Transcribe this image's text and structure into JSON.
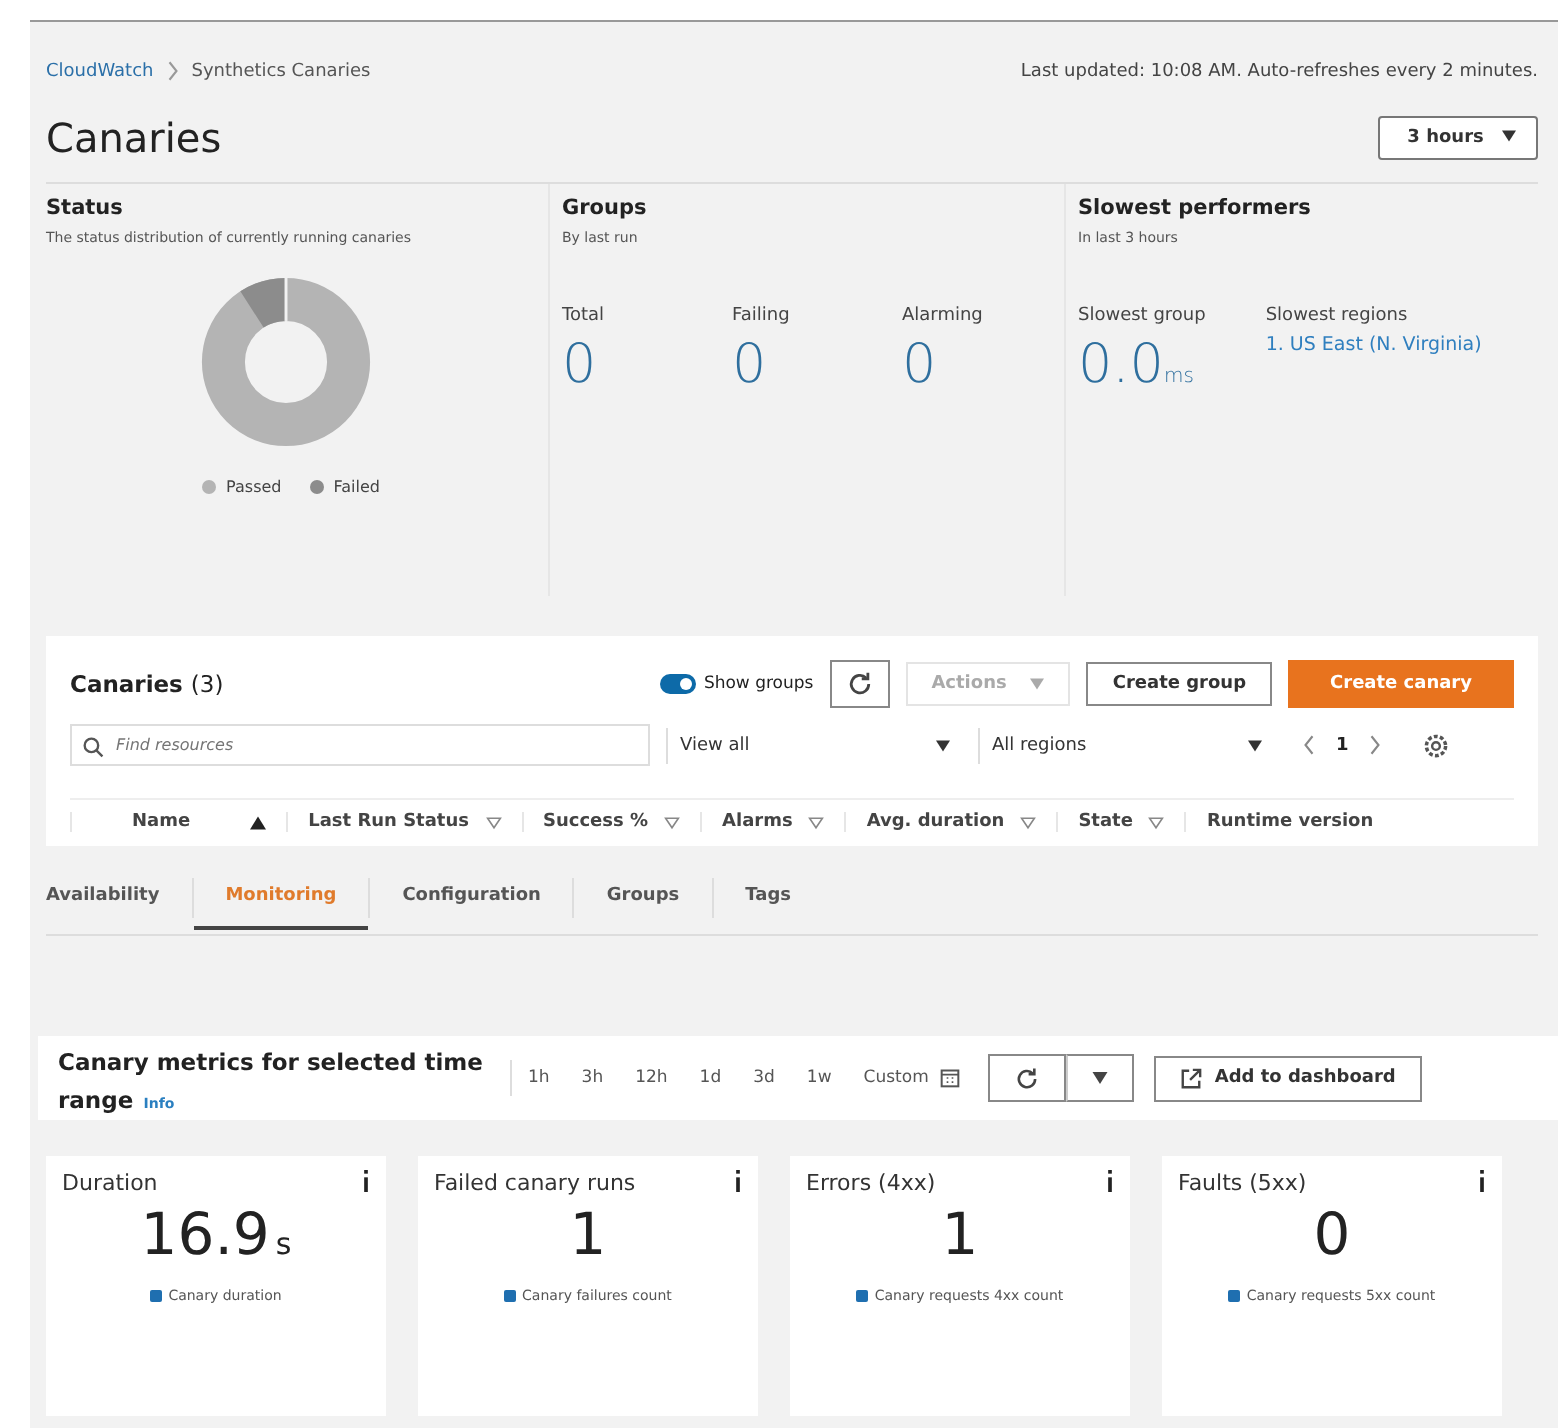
{
  "breadcrumb": [
    "CloudWatch",
    "Synthetics Canaries"
  ],
  "last_updated": "Last updated: 10:08 AM. Auto-refreshes every 2 minutes.",
  "page_title": "Canaries",
  "time_range": "3 hours",
  "status": {
    "title": "Status",
    "subtitle": "The status distribution of currently running canaries",
    "legend": [
      {
        "label": "Passed",
        "color": "#b4b4b4"
      },
      {
        "label": "Failed",
        "color": "#8c8c8c"
      }
    ]
  },
  "groups": {
    "title": "Groups",
    "subtitle": "By last run",
    "stats": [
      {
        "label": "Total",
        "value": "0"
      },
      {
        "label": "Failing",
        "value": "0"
      },
      {
        "label": "Alarming",
        "value": "0"
      }
    ]
  },
  "slowest": {
    "title": "Slowest performers",
    "subtitle": "In last 3 hours",
    "group_label": "Slowest group",
    "group_value": "0.0",
    "group_unit": "ms",
    "regions_label": "Slowest regions",
    "regions": [
      "1. US East (N. Virginia)"
    ]
  },
  "table": {
    "title": "Canaries",
    "count": "(3)",
    "show_groups": {
      "label": "Show groups",
      "on": true
    },
    "actions": {
      "label": "Actions",
      "disabled": true
    },
    "create_group": "Create group",
    "create_canary": "Create canary",
    "search": {
      "placeholder": "Find resources"
    },
    "filters": [
      "View all",
      "All regions"
    ],
    "page": "1",
    "columns": [
      {
        "label": "Name",
        "kind": "sorted"
      },
      {
        "label": "Last Run Status",
        "kind": "sortable"
      },
      {
        "label": "Success %",
        "kind": "sortable"
      },
      {
        "label": "Alarms",
        "kind": "sortable"
      },
      {
        "label": "Avg. duration",
        "kind": "sortable"
      },
      {
        "label": "State",
        "kind": "sortable"
      },
      {
        "label": "Runtime version",
        "kind": "plain"
      }
    ]
  },
  "tabs": [
    {
      "label": "Availability",
      "selected": false
    },
    {
      "label": "Monitoring",
      "selected": true
    },
    {
      "label": "Configuration",
      "selected": false
    },
    {
      "label": "Groups",
      "selected": false
    },
    {
      "label": "Tags",
      "selected": false
    }
  ],
  "metrics": {
    "title": "Canary metrics for selected time range",
    "info": "Info",
    "ranges": [
      "1h",
      "3h",
      "12h",
      "1d",
      "3d",
      "1w",
      "Custom"
    ],
    "add_to_dashboard": "Add to dashboard",
    "cards": [
      {
        "title": "Duration",
        "value": "16.9",
        "unit": "s",
        "legend": "Canary duration"
      },
      {
        "title": "Failed canary runs",
        "value": "1",
        "legend": "Canary failures count"
      },
      {
        "title": "Errors (4xx)",
        "value": "1",
        "legend": "Canary requests 4xx count"
      },
      {
        "title": "Faults (5xx)",
        "value": "0",
        "legend": "Canary requests 5xx count"
      }
    ]
  }
}
